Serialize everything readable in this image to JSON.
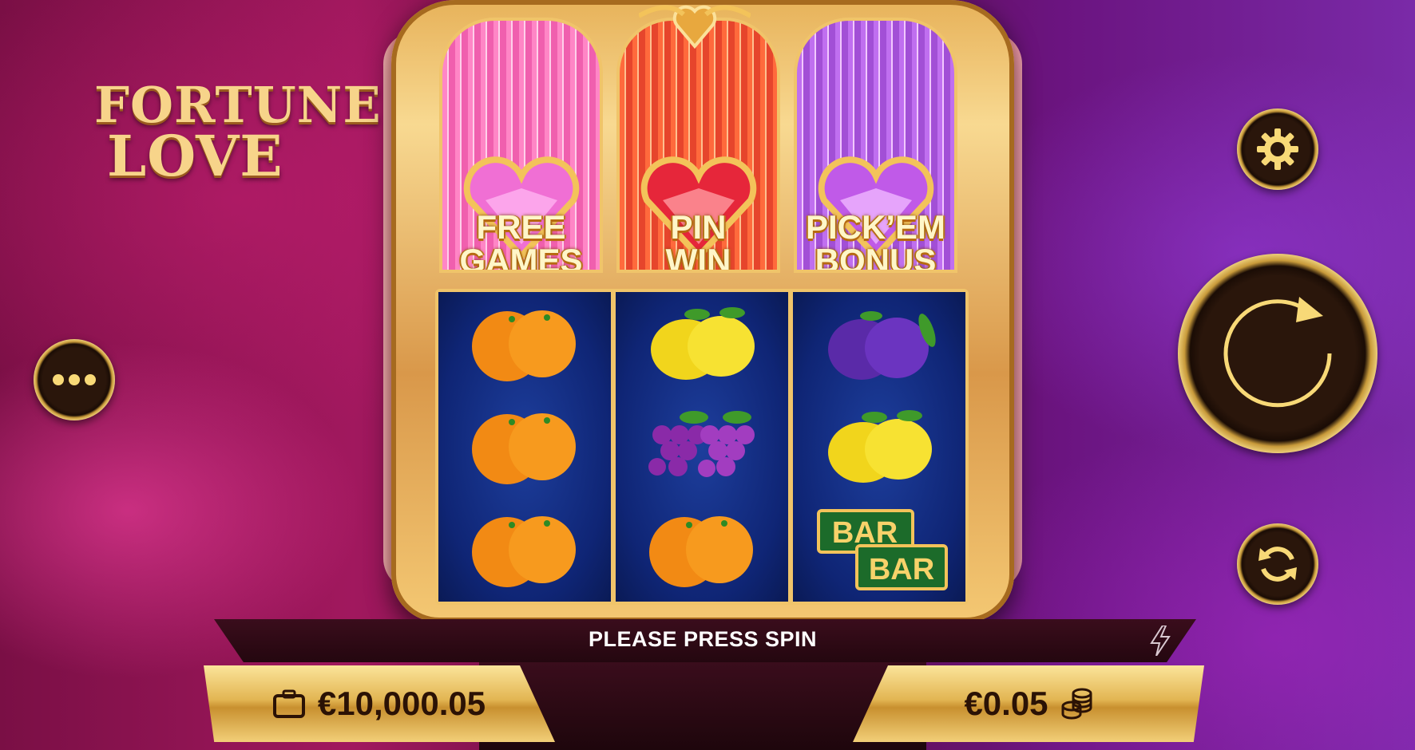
{
  "game": {
    "logo_line1": "FORTUNE",
    "logo_line2": "LOVE"
  },
  "features": [
    {
      "line1": "FREE",
      "line2": "GAMES"
    },
    {
      "line1": "PIN",
      "line2": "WIN"
    },
    {
      "line1": "PICK’EM",
      "line2": "BONUS"
    }
  ],
  "reels": [
    [
      "orange",
      "orange",
      "orange"
    ],
    [
      "lemon",
      "grapes",
      "orange"
    ],
    [
      "plum",
      "lemon",
      "double-bar"
    ]
  ],
  "bar_symbol_text": "BAR",
  "status": {
    "message": "PLEASE PRESS SPIN"
  },
  "balance": {
    "value": "€10,000.05",
    "icon": "wallet-icon"
  },
  "bet": {
    "value": "€0.05",
    "icon": "coins-icon"
  },
  "colors": {
    "gold": "#f0c46a",
    "reel_bg": "#0f2575",
    "free_games_panel": "#ff86c6",
    "pin_win_panel": "#ff6a3c",
    "pickem_panel": "#c06ff0"
  }
}
